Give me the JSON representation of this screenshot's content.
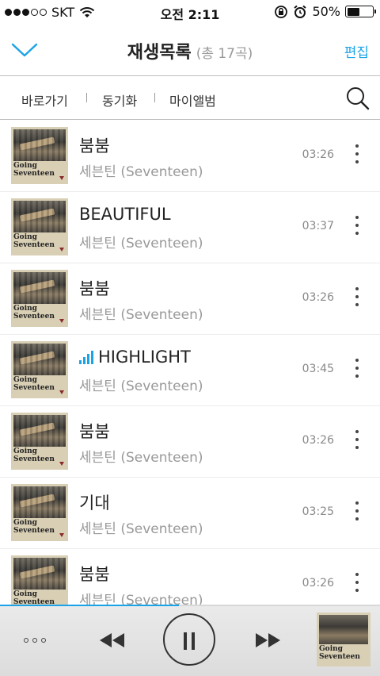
{
  "status_bar": {
    "carrier": "SKT",
    "time": "오전 2:11",
    "battery": "50%",
    "battery_level": 0.5,
    "signal_icon": "signal-dots-icon",
    "wifi_icon": "wifi-icon",
    "rotation_lock_icon": "rotation-lock-icon",
    "alarm_icon": "alarm-icon"
  },
  "header": {
    "title": "재생목록",
    "count": "(총 17곡)",
    "edit_label": "편집",
    "accent_color": "#1aa3e8"
  },
  "tabs": {
    "items": [
      {
        "label": "바로가기"
      },
      {
        "label": "동기화"
      },
      {
        "label": "마이앨범"
      }
    ]
  },
  "playlist": {
    "album_title": "Going Seventeen",
    "songs": [
      {
        "title": "붐붐",
        "artist": "세븐틴 (Seventeen)",
        "duration": "03:26",
        "playing": false
      },
      {
        "title": "BEAUTIFUL",
        "artist": "세븐틴 (Seventeen)",
        "duration": "03:37",
        "playing": false
      },
      {
        "title": "붐붐",
        "artist": "세븐틴 (Seventeen)",
        "duration": "03:26",
        "playing": false
      },
      {
        "title": "HIGHLIGHT",
        "artist": "세븐틴 (Seventeen)",
        "duration": "03:45",
        "playing": true
      },
      {
        "title": "붐붐",
        "artist": "세븐틴 (Seventeen)",
        "duration": "03:26",
        "playing": false
      },
      {
        "title": "기대",
        "artist": "세븐틴 (Seventeen)",
        "duration": "03:25",
        "playing": false
      },
      {
        "title": "붐붐",
        "artist": "세븐틴 (Seventeen)",
        "duration": "03:26",
        "playing": false
      }
    ]
  },
  "player": {
    "progress": 0.47,
    "menu_icon": "more-horizontal-icon",
    "prev_icon": "rewind-icon",
    "pause_icon": "pause-icon",
    "next_icon": "fast-forward-icon"
  }
}
